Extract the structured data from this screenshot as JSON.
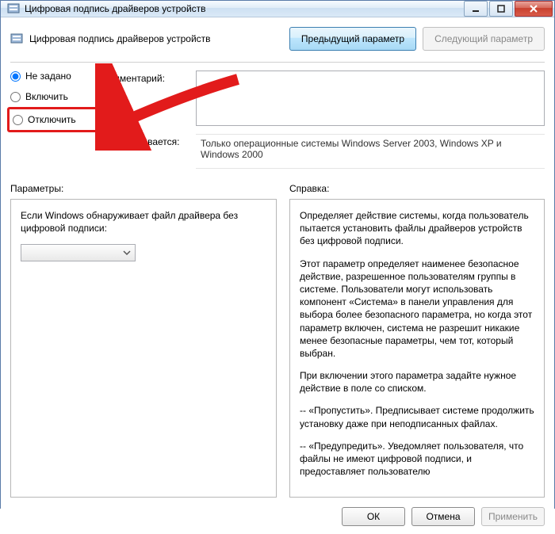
{
  "window": {
    "title": "Цифровая подпись драйверов устройств"
  },
  "header": {
    "title": "Цифровая подпись драйверов устройств",
    "prev": "Предыдущий параметр",
    "next": "Следующий параметр"
  },
  "radios": {
    "not_configured": "Не задано",
    "enabled": "Включить",
    "disabled": "Отключить"
  },
  "fields": {
    "comment_label": "Комментарий:",
    "comment_value": "",
    "supported_label": "Поддерживается:",
    "supported_value": "Только операционные системы Windows Server 2003, Windows XP и Windows 2000"
  },
  "sections": {
    "options_label": "Параметры:",
    "help_label": "Справка:"
  },
  "options": {
    "prompt": "Если Windows обнаруживает файл драйвера без цифровой подписи:",
    "selected": ""
  },
  "help": {
    "p1": "Определяет действие системы, когда пользователь пытается установить файлы драйверов устройств без цифровой подписи.",
    "p2": "Этот параметр определяет наименее безопасное действие, разрешенное пользователям группы в системе. Пользователи могут использовать компонент «Система» в панели управления для выбора более безопасного параметра, но когда этот параметр включен, система не разрешит никакие менее безопасные параметры, чем тот, который выбран.",
    "p3": "При включении этого параметра задайте нужное действие в поле со списком.",
    "p4": "--   «Пропустить». Предписывает системе продолжить установку даже при неподписанных файлах.",
    "p5": "--   «Предупредить». Уведомляет пользователя, что файлы не имеют цифровой подписи, и предоставляет пользователю"
  },
  "footer": {
    "ok": "ОК",
    "cancel": "Отмена",
    "apply": "Применить"
  }
}
